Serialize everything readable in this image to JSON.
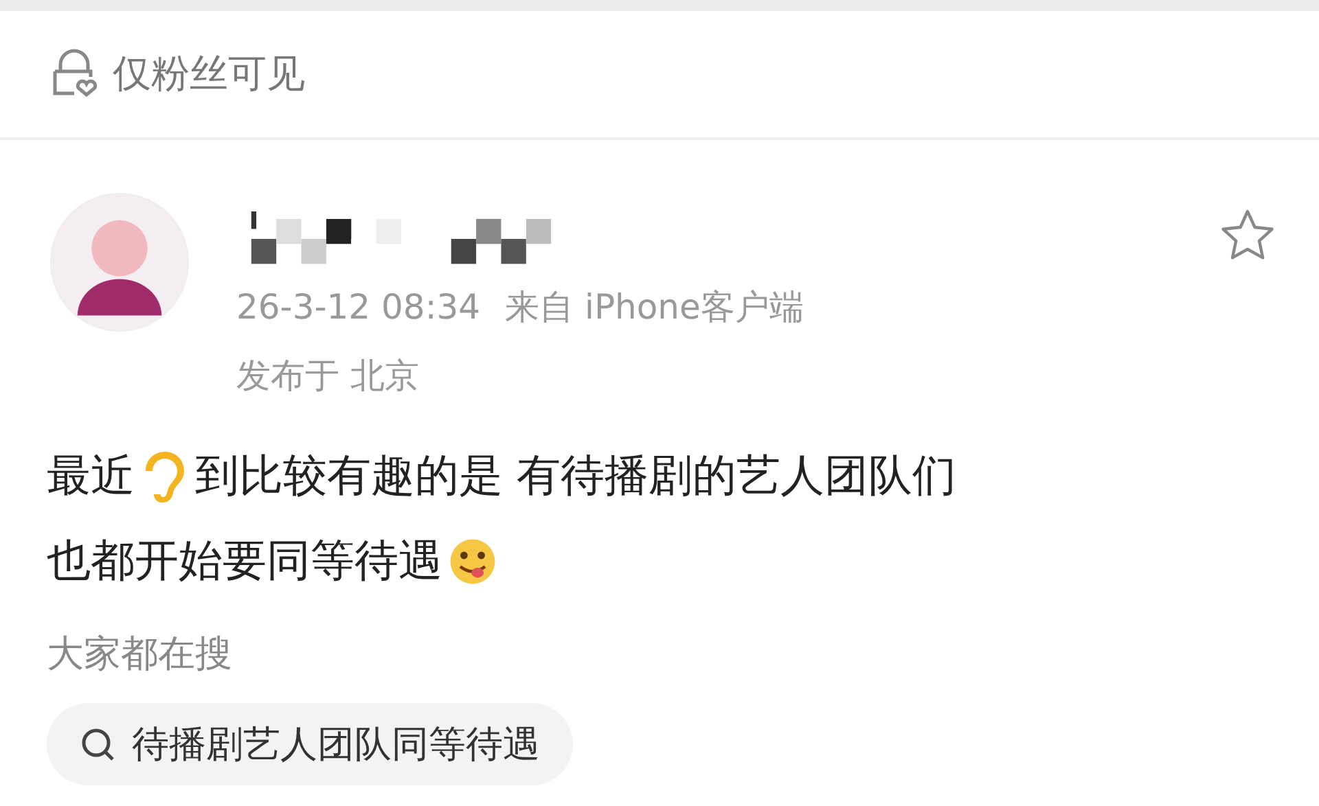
{
  "visibility": {
    "label": "仅粉丝可见"
  },
  "post": {
    "timestamp": "26-3-12 08:34",
    "source": "来自 iPhone客户端",
    "location": "发布于 北京",
    "favorited": false,
    "lines": [
      [
        {
          "kind": "text",
          "text": "最近"
        },
        {
          "kind": "ear"
        },
        {
          "kind": "text",
          "text": "到比较有趣的是 有待播剧的艺人团队们"
        }
      ],
      [
        {
          "kind": "text",
          "text": "也都开始要同等待遇"
        },
        {
          "kind": "tongue"
        }
      ]
    ]
  },
  "trending": {
    "title": "大家都在搜",
    "suggestions": [
      "待播剧艺人团队同等待遇"
    ]
  }
}
